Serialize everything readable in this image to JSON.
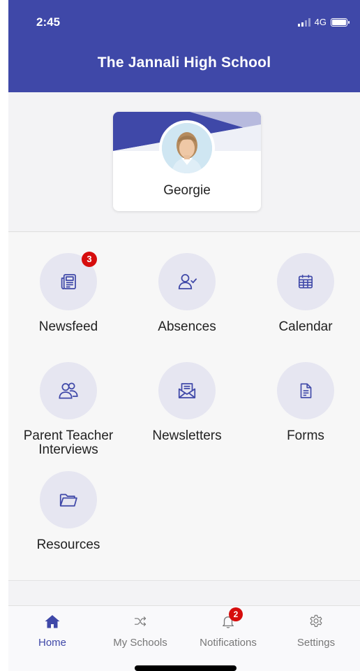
{
  "status_bar": {
    "time": "2:45",
    "network": "4G"
  },
  "header": {
    "title": "The Jannali High School"
  },
  "profile": {
    "name": "Georgie"
  },
  "menu": [
    {
      "label": "Newsfeed",
      "icon": "newspaper-icon",
      "badge": "3"
    },
    {
      "label": "Absences",
      "icon": "user-check-icon"
    },
    {
      "label": "Calendar",
      "icon": "calendar-icon"
    },
    {
      "label": "Parent Teacher\nInterviews",
      "icon": "users-icon"
    },
    {
      "label": "Newsletters",
      "icon": "mail-open-icon"
    },
    {
      "label": "Forms",
      "icon": "document-icon"
    },
    {
      "label": "Resources",
      "icon": "folder-icon"
    }
  ],
  "tabbar": {
    "items": [
      {
        "label": "Home",
        "icon": "home-icon",
        "active": true
      },
      {
        "label": "My Schools",
        "icon": "shuffle-icon"
      },
      {
        "label": "Notifications",
        "icon": "bell-icon",
        "badge": "2"
      },
      {
        "label": "Settings",
        "icon": "gear-icon"
      }
    ]
  },
  "colors": {
    "brand": "#3f48a8",
    "badge": "#d60d0d",
    "icon_bg": "#e6e6f1"
  }
}
